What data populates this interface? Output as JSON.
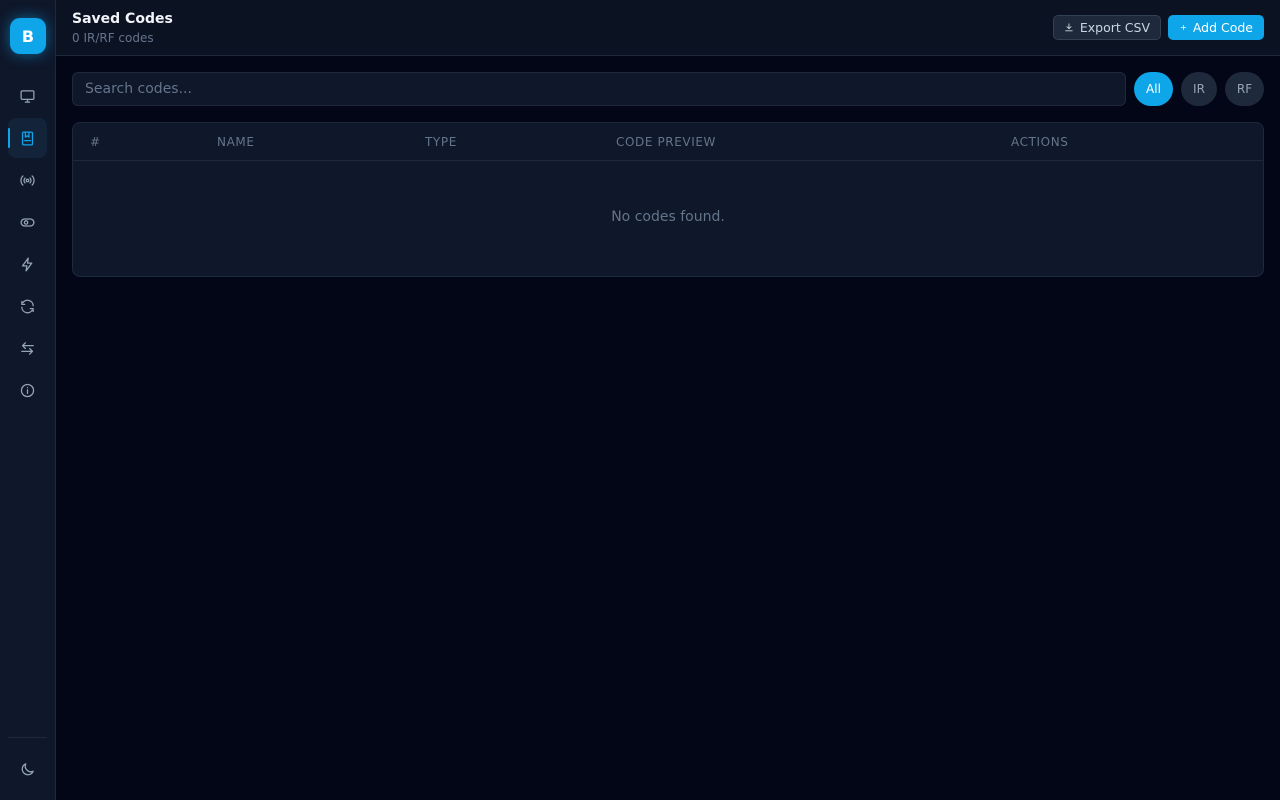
{
  "sidebar": {
    "logo": "B",
    "items": [
      {
        "icon": "monitor-icon",
        "active": false
      },
      {
        "icon": "bookmark-icon",
        "active": true
      },
      {
        "icon": "broadcast-icon",
        "active": false
      },
      {
        "icon": "toggle-icon",
        "active": false
      },
      {
        "icon": "lightning-icon",
        "active": false
      },
      {
        "icon": "refresh-icon",
        "active": false
      },
      {
        "icon": "swap-arrows-icon",
        "active": false
      },
      {
        "icon": "info-icon",
        "active": false
      }
    ],
    "theme_icon": "moon-icon"
  },
  "header": {
    "title": "Saved Codes",
    "subtitle": "0 IR/RF codes",
    "export_label": "Export CSV",
    "add_label": "Add Code"
  },
  "search": {
    "placeholder": "Search codes...",
    "value": ""
  },
  "filters": [
    {
      "label": "All",
      "active": true
    },
    {
      "label": "IR",
      "active": false
    },
    {
      "label": "RF",
      "active": false
    }
  ],
  "table": {
    "columns": [
      "#",
      "NAME",
      "TYPE",
      "CODE PREVIEW",
      "ACTIONS"
    ],
    "rows": [],
    "empty_message": "No codes found."
  },
  "colors": {
    "accent": "#0ea5e9",
    "background": "#020617",
    "panel": "#0f172a"
  }
}
